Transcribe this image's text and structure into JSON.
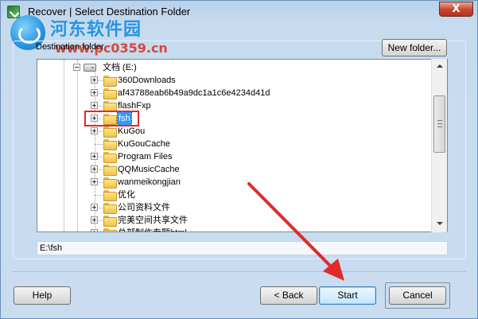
{
  "window": {
    "title": "Recover | Select Destination Folder",
    "close_glyph": "X"
  },
  "watermark": {
    "line1": "河东软件园",
    "line2": "www.pc0359.cn"
  },
  "group": {
    "label": "Destination folder",
    "new_folder_label": "New folder..."
  },
  "tree": {
    "drive_label": "文档 (E:)",
    "items": [
      {
        "label": "360Downloads",
        "expandable": true
      },
      {
        "label": "af43788eab6b49a9dc1a1c6e4234d41d",
        "expandable": true
      },
      {
        "label": "flashFxp",
        "expandable": true
      },
      {
        "label": "fsh",
        "expandable": true,
        "selected": true
      },
      {
        "label": "KuGou",
        "expandable": true
      },
      {
        "label": "KuGouCache",
        "expandable": false
      },
      {
        "label": "Program Files",
        "expandable": true
      },
      {
        "label": "QQMusicCache",
        "expandable": true
      },
      {
        "label": "wanmeikongjian",
        "expandable": true
      },
      {
        "label": "优化",
        "expandable": false
      },
      {
        "label": "公司资料文件",
        "expandable": true
      },
      {
        "label": "完美空间共享文件",
        "expandable": true
      },
      {
        "label": "总部制作专题html",
        "expandable": true
      }
    ]
  },
  "path": {
    "value": "E:\\fsh"
  },
  "buttons": {
    "help": "Help",
    "back": "< Back",
    "start": "Start",
    "cancel": "Cancel"
  },
  "colors": {
    "selection": "#3399ff",
    "annotation_red": "#e02b2b"
  }
}
